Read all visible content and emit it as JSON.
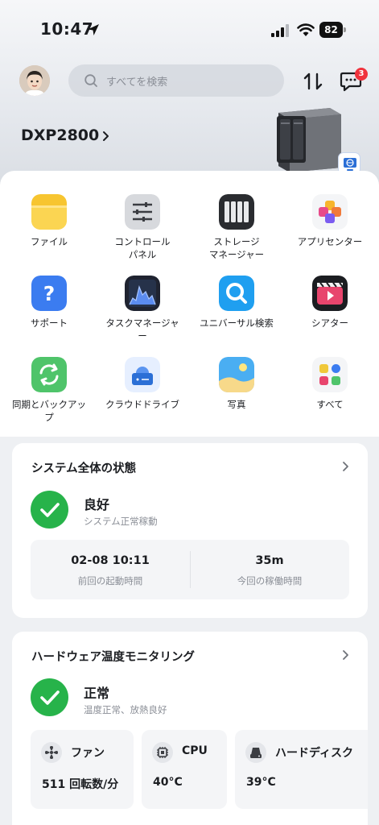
{
  "status_bar": {
    "time": "10:47",
    "battery": "82"
  },
  "header": {
    "search_placeholder": "すべてを検索",
    "notification_count": "3",
    "device_name": "DXP2800"
  },
  "apps": [
    {
      "label": "ファイル",
      "icon": "folder-icon"
    },
    {
      "label": "コントロール\nパネル",
      "icon": "control-panel-icon"
    },
    {
      "label": "ストレージ\nマネージャー",
      "icon": "storage-manager-icon"
    },
    {
      "label": "アプリセンター",
      "icon": "app-center-icon"
    },
    {
      "label": "サポート",
      "icon": "support-icon"
    },
    {
      "label": "タスクマネージャ\nー",
      "icon": "task-manager-icon"
    },
    {
      "label": "ユニバーサル検索",
      "icon": "universal-search-icon"
    },
    {
      "label": "シアター",
      "icon": "theater-icon"
    },
    {
      "label": "同期とバックアッ\nプ",
      "icon": "sync-backup-icon"
    },
    {
      "label": "クラウドドライブ",
      "icon": "cloud-drive-icon"
    },
    {
      "label": "写真",
      "icon": "photos-icon"
    },
    {
      "label": "すべて",
      "icon": "all-apps-icon"
    }
  ],
  "system_status": {
    "title": "システム全体の状態",
    "status": "良好",
    "status_detail": "システム正常稼動",
    "last_boot_value": "02-08 10:11",
    "last_boot_label": "前回の起動時間",
    "uptime_value": "35m",
    "uptime_label": "今回の稼働時間"
  },
  "hardware": {
    "title": "ハードウェア温度モニタリング",
    "status": "正常",
    "status_detail": "温度正常、放熱良好",
    "fan": {
      "title": "ファン",
      "value": "511 回転数/分"
    },
    "cpu": {
      "title": "CPU",
      "value": "40°C"
    },
    "disk": {
      "title": "ハードディスク",
      "value": "39°C"
    }
  },
  "colors": {
    "accent_green": "#27b34a",
    "badge_red": "#f0323c"
  }
}
